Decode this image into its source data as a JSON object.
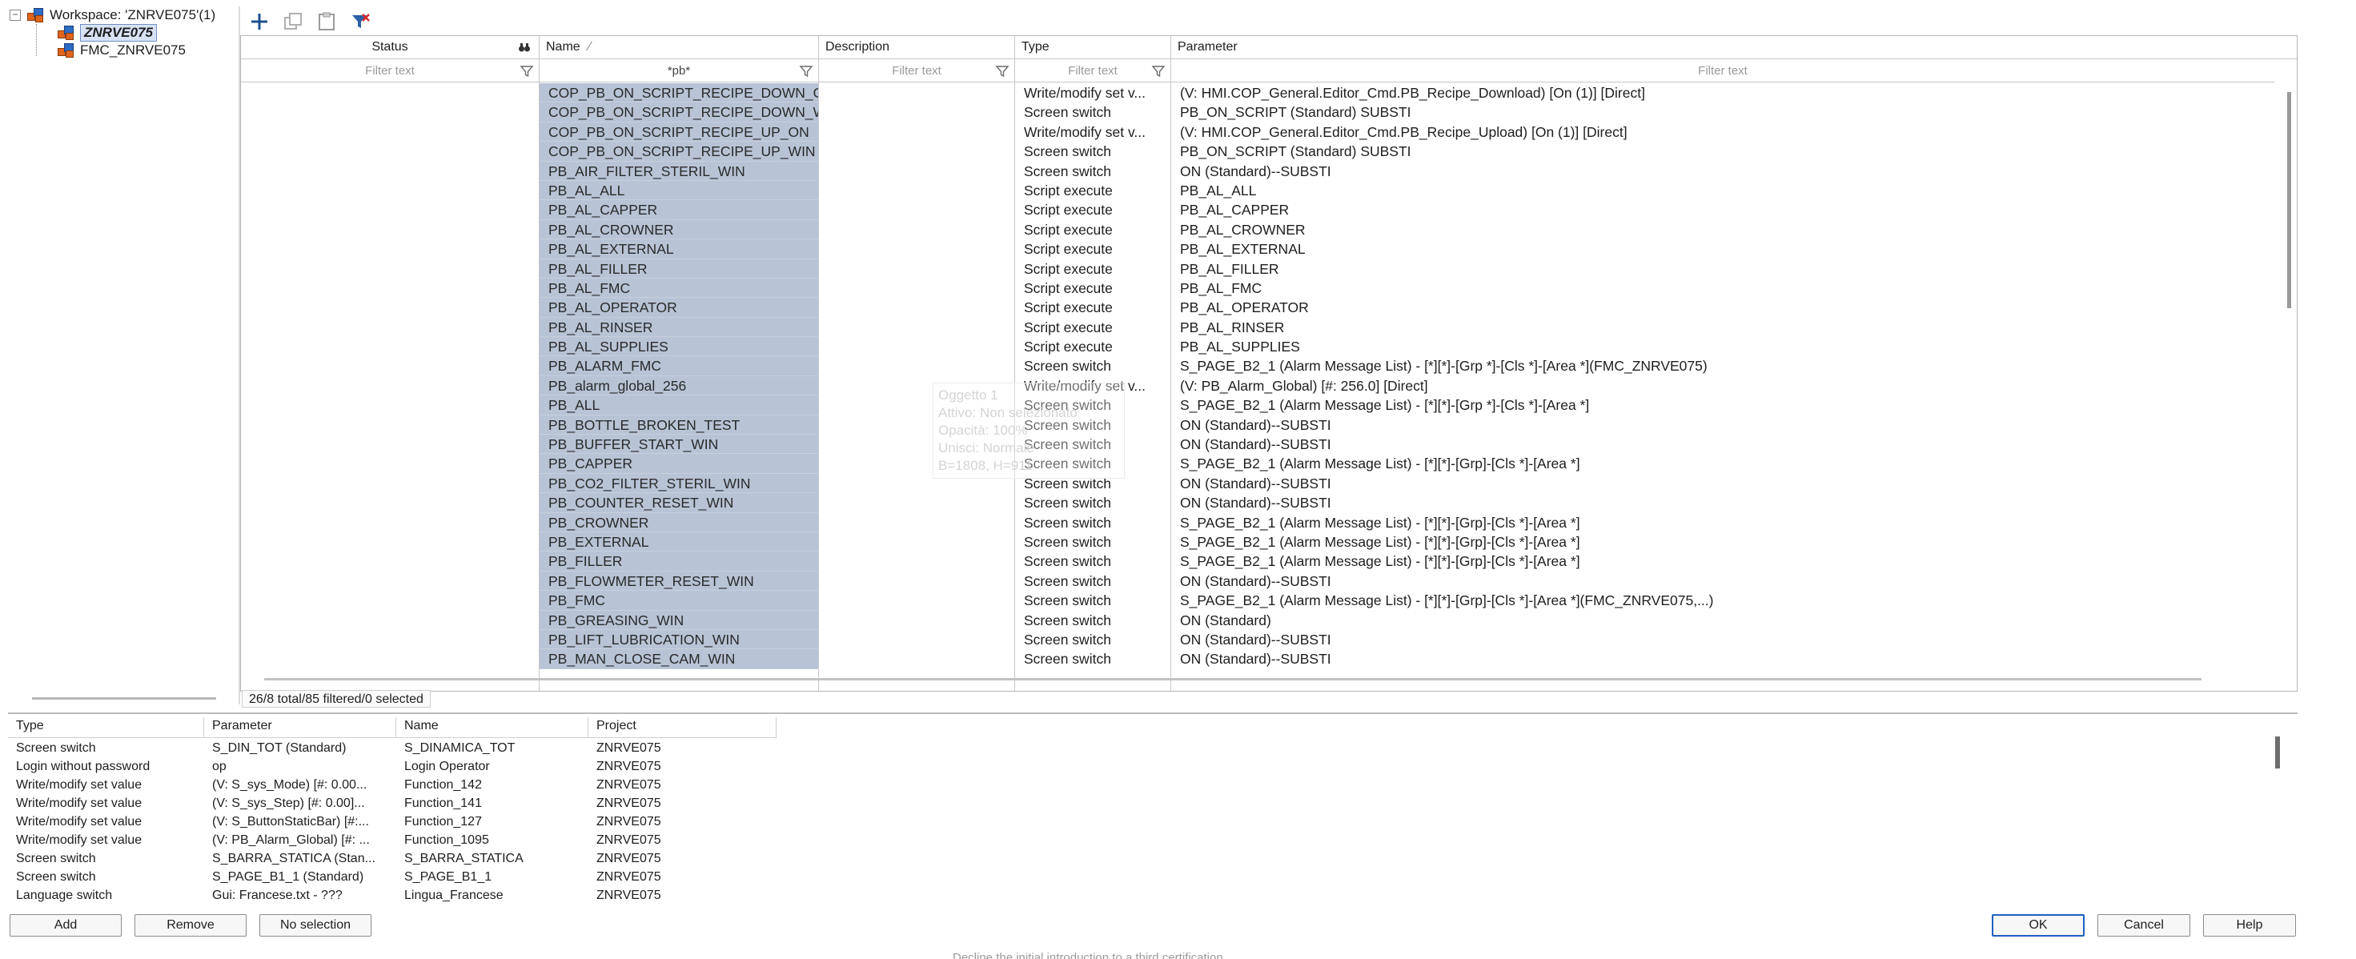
{
  "tree": {
    "workspace_label": "Workspace: 'ZNRVE075'(1)",
    "children": [
      "ZNRVE075",
      "FMC_ZNRVE075"
    ],
    "expander": "−"
  },
  "toolbar": {
    "icons": [
      "add-icon",
      "copy-icon",
      "paste-icon",
      "filter-clear-icon"
    ]
  },
  "grid": {
    "columns": {
      "status": "Status",
      "name": "Name",
      "description": "Description",
      "type": "Type",
      "parameter": "Parameter"
    },
    "sort_indicator": "⁄",
    "filters": {
      "status": "Filter text",
      "name": "*pb*",
      "description": "Filter text",
      "type": "Filter text",
      "parameter": "Filter text"
    },
    "rows": [
      {
        "name": "COP_PB_ON_SCRIPT_RECIPE_DOWN_ON",
        "type": "Write/modify set v...",
        "parameter": "(V: HMI.COP_General.Editor_Cmd.PB_Recipe_Download) [On (1)] [Direct]"
      },
      {
        "name": "COP_PB_ON_SCRIPT_RECIPE_DOWN_WIN",
        "type": "Screen switch",
        "parameter": "PB_ON_SCRIPT (Standard)  SUBSTI"
      },
      {
        "name": "COP_PB_ON_SCRIPT_RECIPE_UP_ON",
        "type": "Write/modify set v...",
        "parameter": "(V: HMI.COP_General.Editor_Cmd.PB_Recipe_Upload) [On (1)] [Direct]"
      },
      {
        "name": "COP_PB_ON_SCRIPT_RECIPE_UP_WIN",
        "type": "Screen switch",
        "parameter": "PB_ON_SCRIPT (Standard)  SUBSTI"
      },
      {
        "name": "PB_AIR_FILTER_STERIL_WIN",
        "type": "Screen switch",
        "parameter": "ON (Standard)--SUBSTI"
      },
      {
        "name": "PB_AL_ALL",
        "type": "Script execute",
        "parameter": "PB_AL_ALL"
      },
      {
        "name": "PB_AL_CAPPER",
        "type": "Script execute",
        "parameter": "PB_AL_CAPPER"
      },
      {
        "name": "PB_AL_CROWNER",
        "type": "Script execute",
        "parameter": "PB_AL_CROWNER"
      },
      {
        "name": "PB_AL_EXTERNAL",
        "type": "Script execute",
        "parameter": "PB_AL_EXTERNAL"
      },
      {
        "name": "PB_AL_FILLER",
        "type": "Script execute",
        "parameter": "PB_AL_FILLER"
      },
      {
        "name": "PB_AL_FMC",
        "type": "Script execute",
        "parameter": "PB_AL_FMC"
      },
      {
        "name": "PB_AL_OPERATOR",
        "type": "Script execute",
        "parameter": "PB_AL_OPERATOR"
      },
      {
        "name": "PB_AL_RINSER",
        "type": "Script execute",
        "parameter": "PB_AL_RINSER"
      },
      {
        "name": "PB_AL_SUPPLIES",
        "type": "Script execute",
        "parameter": "PB_AL_SUPPLIES"
      },
      {
        "name": "PB_ALARM_FMC",
        "type": "Screen switch",
        "parameter": "S_PAGE_B2_1 (Alarm Message List) - [*][*]-[Grp *]-[Cls *]-[Area *](FMC_ZNRVE075)"
      },
      {
        "name": "PB_alarm_global_256",
        "type": "Write/modify set v...",
        "parameter": "(V: PB_Alarm_Global) [#: 256.0] [Direct]"
      },
      {
        "name": "PB_ALL",
        "type": "Screen switch",
        "parameter": "S_PAGE_B2_1 (Alarm Message List) - [*][*]-[Grp *]-[Cls *]-[Area *]"
      },
      {
        "name": "PB_BOTTLE_BROKEN_TEST",
        "type": "Screen switch",
        "parameter": "ON (Standard)--SUBSTI"
      },
      {
        "name": "PB_BUFFER_START_WIN",
        "type": "Screen switch",
        "parameter": "ON (Standard)--SUBSTI"
      },
      {
        "name": "PB_CAPPER",
        "type": "Screen switch",
        "parameter": "S_PAGE_B2_1 (Alarm Message List) - [*][*]-[Grp]-[Cls *]-[Area *]"
      },
      {
        "name": "PB_CO2_FILTER_STERIL_WIN",
        "type": "Screen switch",
        "parameter": "ON (Standard)--SUBSTI"
      },
      {
        "name": "PB_COUNTER_RESET_WIN",
        "type": "Screen switch",
        "parameter": "ON (Standard)--SUBSTI"
      },
      {
        "name": "PB_CROWNER",
        "type": "Screen switch",
        "parameter": "S_PAGE_B2_1 (Alarm Message List) - [*][*]-[Grp]-[Cls *]-[Area *]"
      },
      {
        "name": "PB_EXTERNAL",
        "type": "Screen switch",
        "parameter": "S_PAGE_B2_1 (Alarm Message List) - [*][*]-[Grp]-[Cls *]-[Area *]"
      },
      {
        "name": "PB_FILLER",
        "type": "Screen switch",
        "parameter": "S_PAGE_B2_1 (Alarm Message List) - [*][*]-[Grp]-[Cls *]-[Area *]"
      },
      {
        "name": "PB_FLOWMETER_RESET_WIN",
        "type": "Screen switch",
        "parameter": "ON (Standard)--SUBSTI"
      },
      {
        "name": "PB_FMC",
        "type": "Screen switch",
        "parameter": "S_PAGE_B2_1 (Alarm Message List) - [*][*]-[Grp]-[Cls *]-[Area *](FMC_ZNRVE075,...)"
      },
      {
        "name": "PB_GREASING_WIN",
        "type": "Screen switch",
        "parameter": "ON (Standard)"
      },
      {
        "name": "PB_LIFT_LUBRICATION_WIN",
        "type": "Screen switch",
        "parameter": "ON (Standard)--SUBSTI"
      },
      {
        "name": "PB_MAN_CLOSE_CAM_WIN",
        "type": "Screen switch",
        "parameter": "ON (Standard)--SUBSTI"
      }
    ]
  },
  "ghost_tooltip": [
    "Oggetto 1",
    "Attivo: Non selezionato",
    "Opacità: 100%",
    "Unisci: Normale",
    "B=1808, H=911"
  ],
  "status_line": "26/8 total/85 filtered/0 selected",
  "lower": {
    "columns": {
      "type": "Type",
      "parameter": "Parameter",
      "name": "Name",
      "project": "Project"
    },
    "rows": [
      {
        "type": "Screen switch",
        "parameter": "S_DIN_TOT (Standard)",
        "name": "S_DINAMICA_TOT",
        "project": "ZNRVE075"
      },
      {
        "type": "Login without password",
        "parameter": "op",
        "name": "Login Operator",
        "project": "ZNRVE075"
      },
      {
        "type": "Write/modify set value",
        "parameter": "(V: S_sys_Mode) [#: 0.00...",
        "name": "Function_142",
        "project": "ZNRVE075"
      },
      {
        "type": "Write/modify set value",
        "parameter": "(V: S_sys_Step) [#: 0.00]...",
        "name": "Function_141",
        "project": "ZNRVE075"
      },
      {
        "type": "Write/modify set value",
        "parameter": "(V: S_ButtonStaticBar) [#:...",
        "name": "Function_127",
        "project": "ZNRVE075"
      },
      {
        "type": "Write/modify set value",
        "parameter": "(V: PB_Alarm_Global) [#: ...",
        "name": "Function_1095",
        "project": "ZNRVE075"
      },
      {
        "type": "Screen switch",
        "parameter": "S_BARRA_STATICA (Stan...",
        "name": "S_BARRA_STATICA",
        "project": "ZNRVE075"
      },
      {
        "type": "Screen switch",
        "parameter": "S_PAGE_B1_1 (Standard)",
        "name": "S_PAGE_B1_1",
        "project": "ZNRVE075"
      },
      {
        "type": "Language switch",
        "parameter": "Gui: Francese.txt - ???",
        "name": "Lingua_Francese",
        "project": "ZNRVE075"
      }
    ]
  },
  "buttons": {
    "add": "Add",
    "remove": "Remove",
    "no_selection": "No selection",
    "ok": "OK",
    "cancel": "Cancel",
    "help": "Help"
  },
  "bottom_text": "Decline the initial introduction to a third certification",
  "colors": {
    "name_highlight": "#b8c3d6",
    "default_button_border": "#1f5fc0",
    "tree_selection": "#d7e3f5"
  }
}
